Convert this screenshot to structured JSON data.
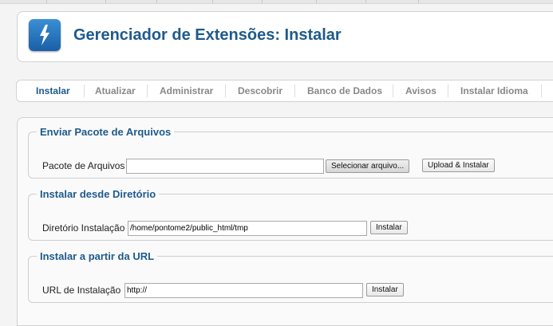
{
  "header": {
    "title": "Gerenciador de Extensões: Instalar",
    "icon": "extension-manager-icon"
  },
  "tabs": [
    {
      "label": "Instalar",
      "active": true
    },
    {
      "label": "Atualizar"
    },
    {
      "label": "Administrar"
    },
    {
      "label": "Descobrir"
    },
    {
      "label": "Banco de Dados"
    },
    {
      "label": "Avisos"
    },
    {
      "label": "Instalar Idioma"
    }
  ],
  "upload": {
    "legend": "Enviar Pacote de Arquivos",
    "label": "Pacote de Arquivos",
    "file_value": "",
    "choose_button": "Selecionar arquivo...",
    "submit_button": "Upload & Instalar"
  },
  "directory": {
    "legend": "Instalar desde Diretório",
    "label": "Diretório Instalação",
    "value": "/home/pontome2/public_html/tmp",
    "submit_button": "Instalar"
  },
  "url": {
    "legend": "Instalar a partir da URL",
    "label": "URL de Instalação",
    "value": "http://",
    "submit_button": "Instalar"
  },
  "colors": {
    "accent": "#1e5a8c",
    "tab_inactive": "#888888",
    "icon_blue": "#2a7cc7"
  }
}
